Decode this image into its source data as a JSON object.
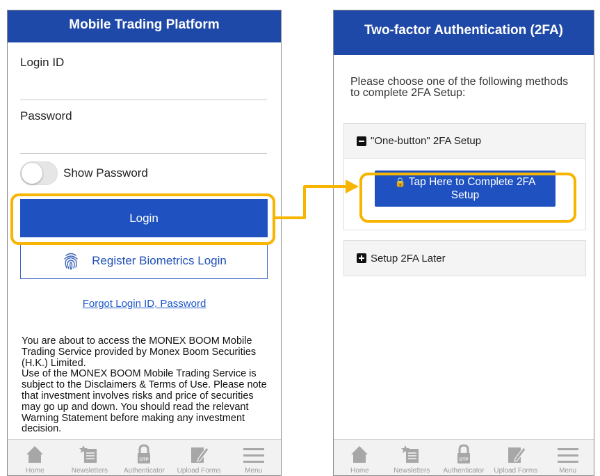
{
  "left_screen": {
    "title": "Mobile Trading Platform",
    "login_id": {
      "label": "Login ID",
      "value": ""
    },
    "password": {
      "label": "Password",
      "value": ""
    },
    "show_password": {
      "label": "Show Password",
      "enabled": false
    },
    "login_button": "Login",
    "biometrics_button": "Register Biometrics Login",
    "forgot_link": "Forgot Login ID, Password",
    "disclaimer": [
      "You are about to access the MONEX BOOM Mobile Trading Service provided by Monex Boom Securities (H.K.) Limited.",
      "Use of the MONEX BOOM Mobile Trading Service is subject to the Disclaimers & Terms of Use. Please note that investment involves risks and price of securities may go up and down. You should read the relevant Warning Statement before making any investment decision."
    ]
  },
  "right_screen": {
    "title": "Two-factor Authentication (2FA)",
    "instruction": "Please choose one of the following methods to complete 2FA Setup:",
    "one_button_header": "\"One-button\" 2FA Setup",
    "tap_button": {
      "icon": "lock-icon",
      "line1": "Tap Here to Complete 2FA",
      "line2": "Setup"
    },
    "later_header": "Setup 2FA Later"
  },
  "tabbar": [
    {
      "label": "Home",
      "icon": "home-icon"
    },
    {
      "label": "Newsletters",
      "icon": "newsletters-icon"
    },
    {
      "label": "Authenticator",
      "icon": "authenticator-icon"
    },
    {
      "label": "Upload Forms",
      "icon": "upload-forms-icon"
    },
    {
      "label": "Menu",
      "icon": "menu-icon"
    }
  ],
  "colors": {
    "header_blue": "#1f49a8",
    "button_blue": "#1f52c0",
    "link_blue": "#1e57c8",
    "highlight": "#f7b500"
  }
}
